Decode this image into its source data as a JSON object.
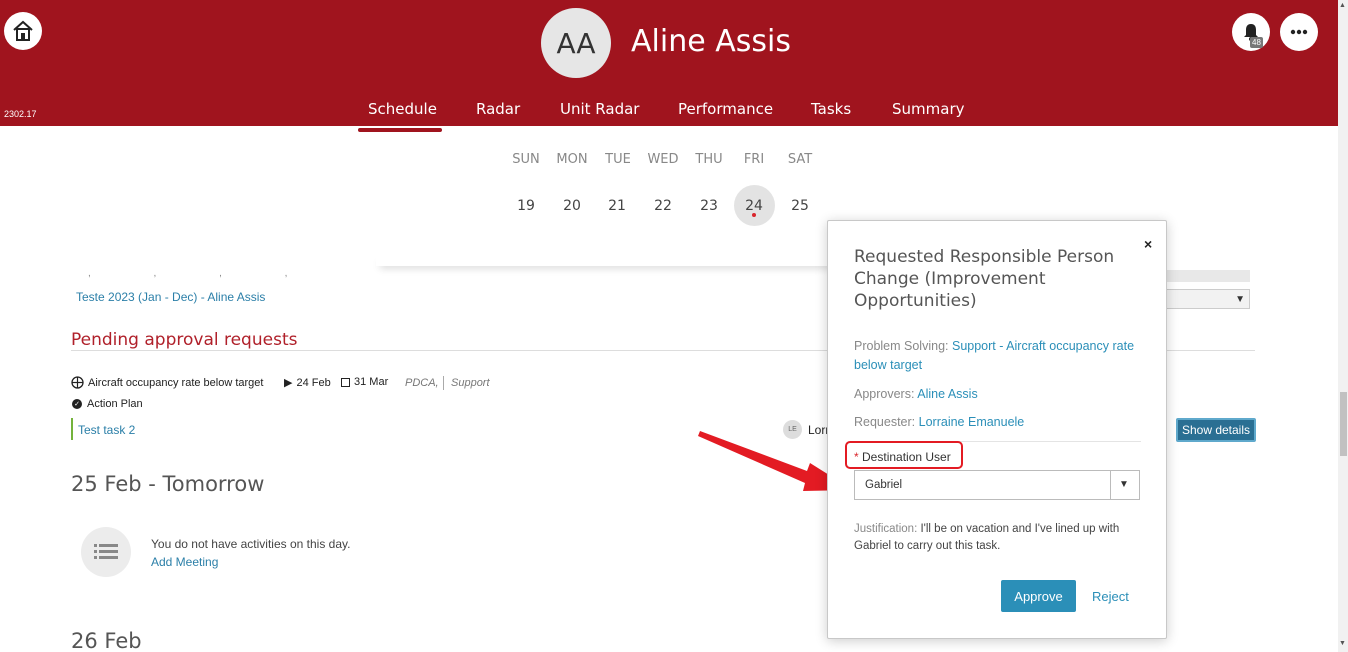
{
  "header": {
    "version": "2302.17",
    "avatar_initials": "AA",
    "user_name": "Aline Assis",
    "notification_count": "48",
    "home_icon": "home-icon",
    "bell_icon": "bell-icon",
    "more_icon": "ellipsis-icon",
    "background_color": "#a0141e"
  },
  "tabs": [
    {
      "label": "Schedule",
      "active": true
    },
    {
      "label": "Radar"
    },
    {
      "label": "Unit Radar"
    },
    {
      "label": "Performance"
    },
    {
      "label": "Tasks"
    },
    {
      "label": "Summary"
    }
  ],
  "week": {
    "days": [
      "SUN",
      "MON",
      "TUE",
      "WED",
      "THU",
      "FRI",
      "SAT"
    ],
    "dates": [
      "19",
      "20",
      "21",
      "22",
      "23",
      "24",
      "25"
    ],
    "today": "24"
  },
  "background": {
    "plan_link": "Teste 2023 (Jan - Dec) - Aline Assis",
    "pending_title": "Pending approval requests",
    "item": {
      "title": "Aircraft occupancy rate below target",
      "start": "24 Feb",
      "end": "31 Mar",
      "method": "PDCA,",
      "area": "Support",
      "type": "Action Plan",
      "task": "Test task 2",
      "assignee_initials": "LE",
      "assignee_partial": "Lorr",
      "show_details": "Show details"
    },
    "tomorrow_head": "25 Feb - Tomorrow",
    "no_activities": "You do not have activities on this day.",
    "add_meeting": "Add Meeting",
    "next_head": "26 Feb"
  },
  "modal": {
    "title": "Requested Responsible Person Change (Improvement Opportunities)",
    "close": "×",
    "problem_label": "Problem Solving:",
    "problem_value": "Support - Aircraft occupancy rate below target",
    "approvers_label": "Approvers:",
    "approvers_value": "Aline Assis",
    "requester_label": "Requester:",
    "requester_value": "Lorraine Emanuele",
    "required_mark": "*",
    "destination_label": "Destination User",
    "destination_value": "Gabriel",
    "justification_label": "Justification:",
    "justification_value": "I'll be on vacation and I've lined up with Gabriel to carry out this task.",
    "approve": "Approve",
    "reject": "Reject",
    "accent_color": "#2b8fb8"
  },
  "annotation": {
    "highlight_color": "#e31b23"
  }
}
